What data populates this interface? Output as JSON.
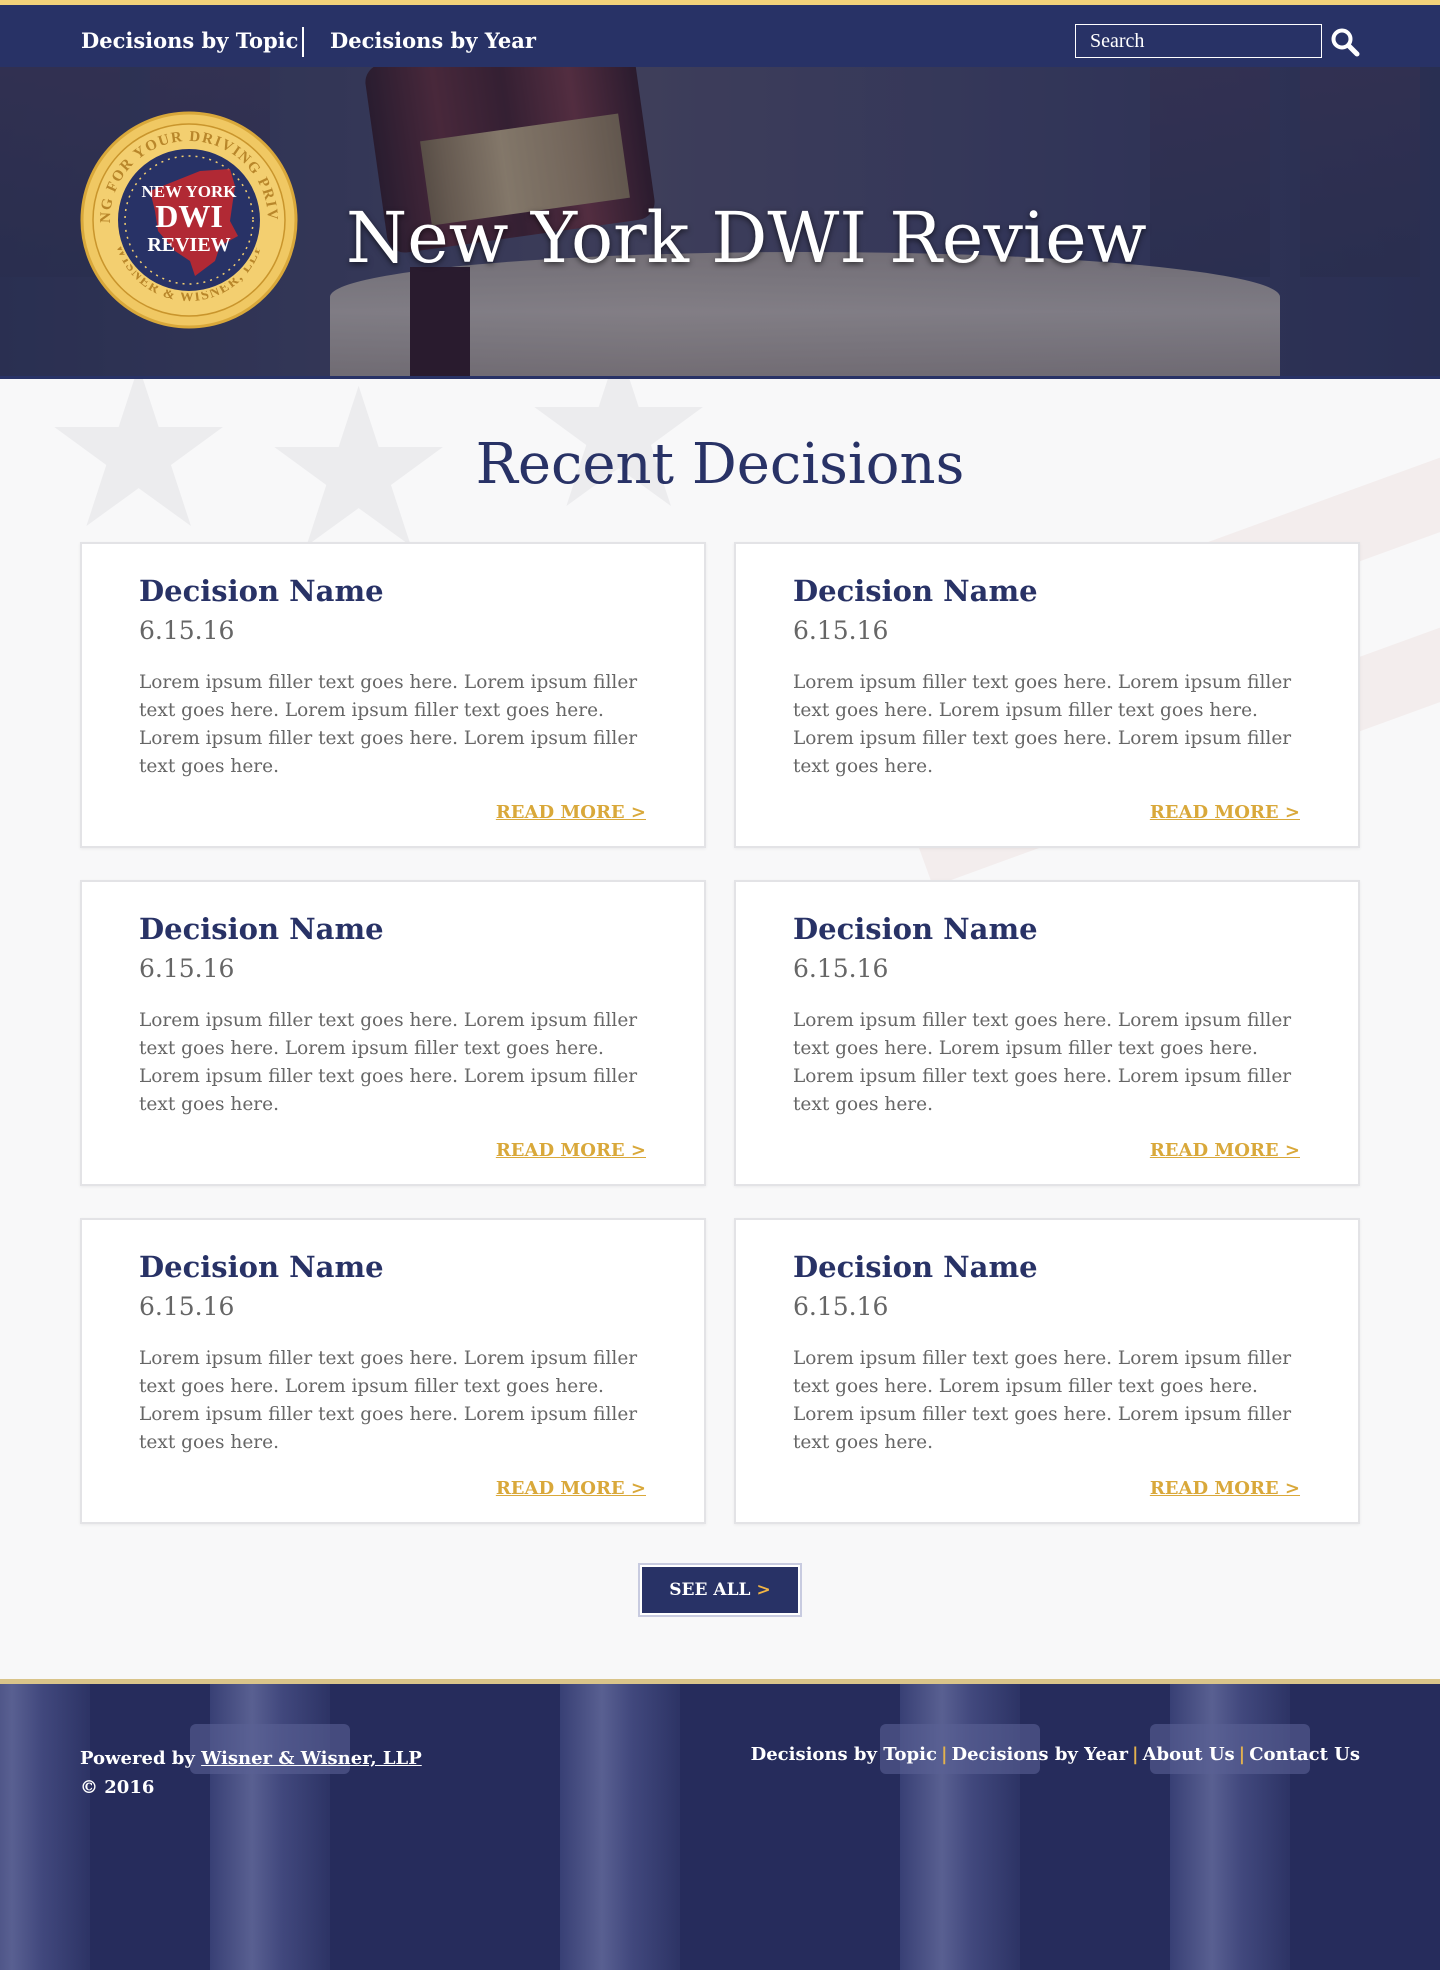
{
  "nav": {
    "topic_label": "Decisions by Topic",
    "year_label": "Decisions by Year",
    "search_placeholder": "Search"
  },
  "hero": {
    "title": "New York DWI Review",
    "seal": {
      "ring_top": "FIGHTING FOR YOUR DRIVING PRIVILEGES",
      "ring_bottom": "WISNER & WISNER, LLP",
      "line1": "NEW YORK",
      "line2": "DWI",
      "line3": "REVIEW"
    }
  },
  "recent": {
    "title": "Recent Decisions",
    "cards": [
      {
        "name": "Decision Name",
        "date": "6.15.16",
        "body": "Lorem ipsum filler text goes here. Lorem ipsum filler text goes here. Lorem ipsum filler text goes here. Lorem ipsum filler text goes here. Lorem ipsum filler text goes here.",
        "more": "READ MORE >"
      },
      {
        "name": "Decision Name",
        "date": "6.15.16",
        "body": "Lorem ipsum filler text goes here. Lorem ipsum filler text goes here. Lorem ipsum filler text goes here. Lorem ipsum filler text goes here. Lorem ipsum filler text goes here.",
        "more": "READ MORE >"
      },
      {
        "name": "Decision Name",
        "date": "6.15.16",
        "body": "Lorem ipsum filler text goes here. Lorem ipsum filler text goes here. Lorem ipsum filler text goes here. Lorem ipsum filler text goes here. Lorem ipsum filler text goes here.",
        "more": "READ MORE >"
      },
      {
        "name": "Decision Name",
        "date": "6.15.16",
        "body": "Lorem ipsum filler text goes here. Lorem ipsum filler text goes here. Lorem ipsum filler text goes here. Lorem ipsum filler text goes here. Lorem ipsum filler text goes here.",
        "more": "READ MORE >"
      },
      {
        "name": "Decision Name",
        "date": "6.15.16",
        "body": "Lorem ipsum filler text goes here. Lorem ipsum filler text goes here. Lorem ipsum filler text goes here. Lorem ipsum filler text goes here. Lorem ipsum filler text goes here.",
        "more": "READ MORE >"
      },
      {
        "name": "Decision Name",
        "date": "6.15.16",
        "body": "Lorem ipsum filler text goes here. Lorem ipsum filler text goes here. Lorem ipsum filler text goes here. Lorem ipsum filler text goes here. Lorem ipsum filler text goes here.",
        "more": "READ MORE >"
      }
    ],
    "see_all_label": "SEE ALL",
    "see_all_chevron": ">"
  },
  "footer": {
    "powered_prefix": "Powered by ",
    "powered_link": "Wisner & Wisner, LLP",
    "copyright": "© 2016",
    "links": [
      "Decisions by Topic",
      "Decisions by Year",
      "About Us",
      "Contact Us"
    ],
    "separator": "|"
  },
  "colors": {
    "navy": "#283266",
    "gold": "#d9a83a",
    "accent_top": "#f2d27a"
  },
  "icons": {
    "search": "search-icon",
    "seal": "seal-icon"
  }
}
